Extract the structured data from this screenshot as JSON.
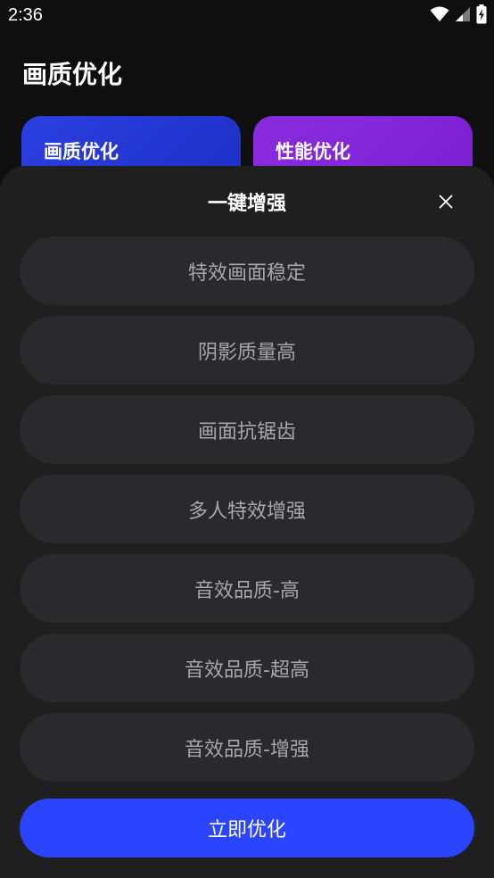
{
  "status_bar": {
    "time": "2:36",
    "icons": [
      "wifi-icon",
      "cell-signal-icon",
      "battery-charging-icon"
    ]
  },
  "header": {
    "title": "画质优化"
  },
  "cards": [
    {
      "label": "画质优化",
      "color": "#2b3fe0"
    },
    {
      "label": "性能优化",
      "color": "#8b2be0"
    }
  ],
  "sheet": {
    "title": "一键增强",
    "close_icon": "close-icon",
    "options": [
      "特效画面稳定",
      "阴影质量高",
      "画面抗锯齿",
      "多人特效增强",
      "音效品质-高",
      "音效品质-超高",
      "音效品质-增强"
    ],
    "primary_button": "立即优化",
    "primary_color": "#2b44ff"
  }
}
